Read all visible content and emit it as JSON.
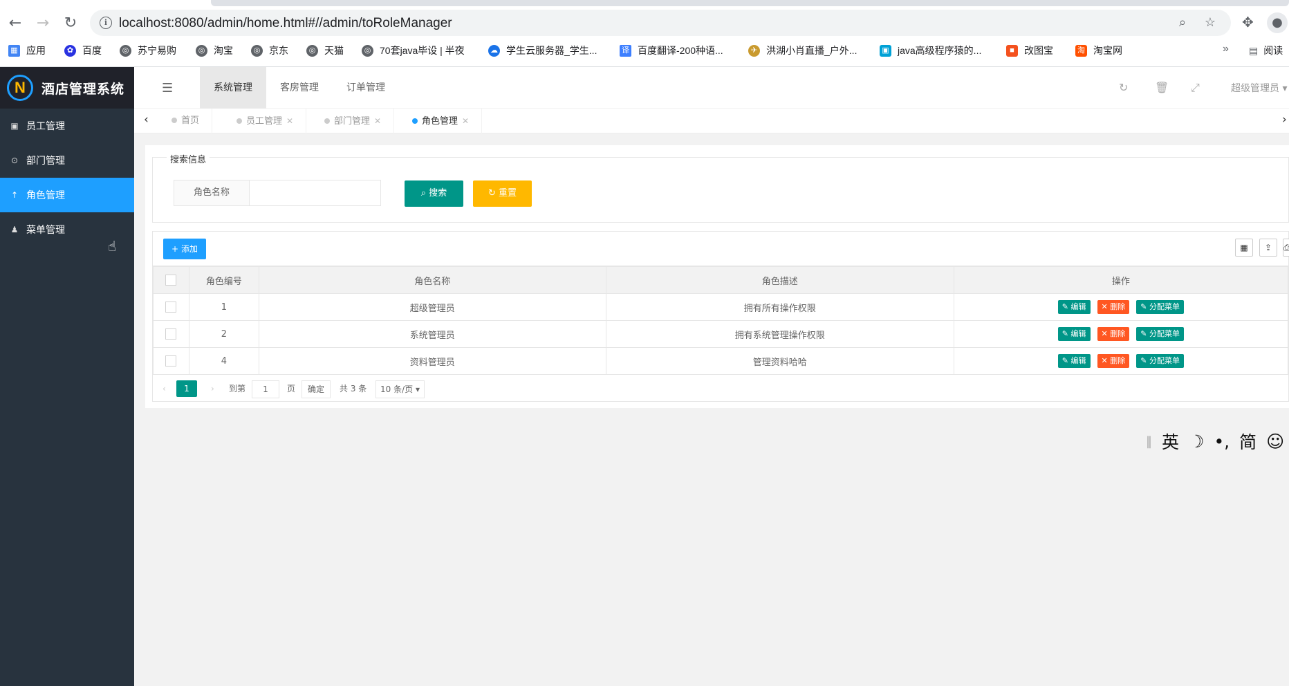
{
  "browser": {
    "url": "localhost:8080/admin/home.html#//admin/toRoleManager",
    "bookmarks": [
      {
        "label": "应用",
        "icon": "apps-grid-icon",
        "color": "#4285f4"
      },
      {
        "label": "百度",
        "icon": "baidu-paw-icon",
        "color": "#2932e1"
      },
      {
        "label": "苏宁易购",
        "icon": "globe-icon",
        "color": "#5f6368"
      },
      {
        "label": "淘宝",
        "icon": "globe-icon",
        "color": "#5f6368"
      },
      {
        "label": "京东",
        "icon": "globe-icon",
        "color": "#5f6368"
      },
      {
        "label": "天猫",
        "icon": "globe-icon",
        "color": "#5f6368"
      },
      {
        "label": "70套java毕设 | 半夜",
        "icon": "globe-icon",
        "color": "#5f6368"
      },
      {
        "label": "学生云服务器_学生...",
        "icon": "cloud-icon",
        "color": "#1a73e8"
      },
      {
        "label": "百度翻译-200种语...",
        "icon": "translate-icon",
        "color": "#3d7fff"
      },
      {
        "label": "洪湖小肖直播_户外...",
        "icon": "bird-icon",
        "color": "#c99a2e"
      },
      {
        "label": "java高级程序猿的...",
        "icon": "bilibili-icon",
        "color": "#00a1d6"
      },
      {
        "label": "改图宝",
        "icon": "square-icon",
        "color": "#f4511e"
      },
      {
        "label": "淘宝网",
        "icon": "taobao-icon",
        "color": "#ff5000"
      }
    ],
    "more": "»",
    "reading": "阅读"
  },
  "app": {
    "logo_text": "酒店管理系统",
    "sidebar": [
      {
        "label": "员工管理",
        "icon": "user-card-icon"
      },
      {
        "label": "部门管理",
        "icon": "circle-dot-icon"
      },
      {
        "label": "角色管理",
        "icon": "up-arrow-icon"
      },
      {
        "label": "菜单管理",
        "icon": "users-icon"
      }
    ],
    "top_nav": [
      "系统管理",
      "客房管理",
      "订单管理"
    ],
    "user": "超级管理员",
    "page_tabs": [
      "首页",
      "员工管理",
      "部门管理",
      "角色管理"
    ]
  },
  "search": {
    "legend": "搜索信息",
    "field_label": "角色名称",
    "field_value": "",
    "search_label": "搜索",
    "reset_label": "重置"
  },
  "table": {
    "add_label": "添加",
    "columns": [
      "角色编号",
      "角色名称",
      "角色描述",
      "操作"
    ],
    "rows": [
      {
        "id": "1",
        "name": "超级管理员",
        "desc": "拥有所有操作权限"
      },
      {
        "id": "2",
        "name": "系统管理员",
        "desc": "拥有系统管理操作权限"
      },
      {
        "id": "4",
        "name": "资料管理员",
        "desc": "管理资料哈哈"
      }
    ],
    "actions": {
      "edit": "编辑",
      "delete": "删除",
      "assign": "分配菜单"
    }
  },
  "pager": {
    "current": "1",
    "goto_prefix": "到第",
    "goto_value": "1",
    "page_suffix": "页",
    "confirm": "确定",
    "total": "共 3 条",
    "page_size": "10 条/页"
  },
  "ime": [
    "英",
    "☽",
    "•,",
    "简",
    "☺"
  ]
}
